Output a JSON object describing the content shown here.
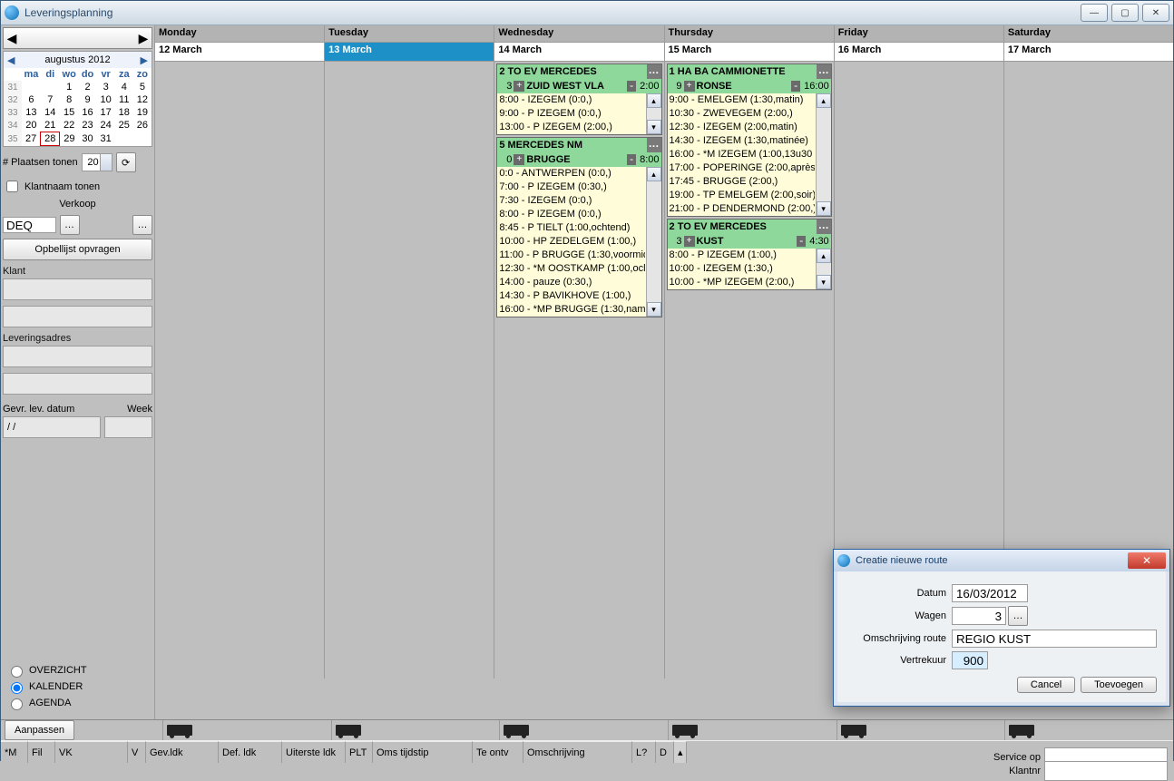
{
  "window": {
    "title": "Leveringsplanning"
  },
  "minical": {
    "title": "augustus 2012",
    "dow": [
      "ma",
      "di",
      "wo",
      "do",
      "vr",
      "za",
      "zo"
    ],
    "weeks": [
      {
        "wk": "31",
        "d": [
          "",
          "",
          "1",
          "2",
          "3",
          "4",
          "5"
        ]
      },
      {
        "wk": "32",
        "d": [
          "6",
          "7",
          "8",
          "9",
          "10",
          "11",
          "12"
        ]
      },
      {
        "wk": "33",
        "d": [
          "13",
          "14",
          "15",
          "16",
          "17",
          "18",
          "19"
        ]
      },
      {
        "wk": "34",
        "d": [
          "20",
          "21",
          "22",
          "23",
          "24",
          "25",
          "26"
        ]
      },
      {
        "wk": "35",
        "d": [
          "27",
          "28",
          "29",
          "30",
          "31",
          "",
          ""
        ]
      }
    ],
    "today": "28"
  },
  "sidebar": {
    "plaatsen_lbl": "# Plaatsen tonen",
    "plaatsen_val": "20",
    "klantnaam_lbl": "Klantnaam tonen",
    "verkoop_lbl": "Verkoop",
    "deq": "DEQ",
    "opbel_btn": "Opbellijst opvragen",
    "klant_lbl": "Klant",
    "lev_lbl": "Leveringsadres",
    "gevr_lbl": "Gevr. lev. datum",
    "week_lbl": "Week",
    "date_blank": "/  /",
    "views": {
      "overzicht": "OVERZICHT",
      "kalender": "KALENDER",
      "agenda": "AGENDA"
    },
    "aanpassen": "Aanpassen"
  },
  "days": [
    {
      "name": "Monday",
      "date": "12 March"
    },
    {
      "name": "Tuesday",
      "date": "13 March",
      "selected": true
    },
    {
      "name": "Wednesday",
      "date": "14 March"
    },
    {
      "name": "Thursday",
      "date": "15 March"
    },
    {
      "name": "Friday",
      "date": "16 March"
    },
    {
      "name": "Saturday",
      "date": "17 March"
    }
  ],
  "routes_wed": [
    {
      "hdr": "2 TO EV MERCEDES",
      "num": "3",
      "name": "ZUID WEST VLA",
      "time": "2:00",
      "items": [
        "8:00 - IZEGEM (0:0,)",
        "9:00 - P IZEGEM (0:0,)",
        "13:00 - P IZEGEM (2:00,)"
      ]
    },
    {
      "hdr": "5   MERCEDES NM",
      "num": "0",
      "name": "BRUGGE",
      "time": "8:00",
      "items": [
        "0:0 - ANTWERPEN (0:0,)",
        "7:00 - P IZEGEM (0:30,)",
        "7:30 - IZEGEM (0:0,)",
        "8:00 - P IZEGEM (0:0,)",
        "8:45 - P TIELT (1:00,ochtend)",
        "10:00 - HP ZEDELGEM (1:00,)",
        "11:00 - P BRUGGE (1:30,voormid",
        "12:30 - *M OOSTKAMP (1:00,ocl",
        "14:00 - pauze (0:30,)",
        "14:30 - P BAVIKHOVE (1:00,)",
        "16:00 - *MP BRUGGE (1:30,nam"
      ]
    }
  ],
  "routes_thu": [
    {
      "hdr": "1 HA BA CAMMIONETTE",
      "num": "9",
      "name": "RONSE",
      "time": "16:00",
      "items": [
        "9:00 - EMELGEM (1:30,matin)",
        "10:30 - ZWEVEGEM (2:00,)",
        "12:30 - IZEGEM (2:00,matin)",
        "14:30 - IZEGEM (1:30,matinée)",
        "16:00 - *M IZEGEM (1:00,13u30",
        "17:00 - POPERINGE (2:00,après-",
        "17:45 - BRUGGE (2:00,)",
        "19:00 - TP EMELGEM (2:00,soir)",
        "21:00 - P DENDERMOND (2:00,)"
      ]
    },
    {
      "hdr": "2 TO EV MERCEDES",
      "num": "3",
      "name": "KUST",
      "time": "4:30",
      "items": [
        "8:00 - P IZEGEM (1:00,)",
        "10:00 - IZEGEM (1:30,)",
        "10:00 - *MP IZEGEM (2:00,)"
      ]
    }
  ],
  "grid": {
    "cols": [
      "*M",
      "Fil",
      "VK",
      "V",
      "Gev.ldk",
      "Def. ldk",
      "Uiterste ldk",
      "PLT",
      "Oms tijdstip",
      "Te ontv",
      "Omschrijving",
      "L?",
      "D"
    ],
    "widths": [
      30,
      30,
      80,
      20,
      80,
      70,
      70,
      30,
      110,
      56,
      120,
      26,
      20
    ],
    "service_lbl": "Service op",
    "klantnr_lbl": "Klantnr"
  },
  "dialog": {
    "title": "Creatie nieuwe route",
    "datum_lbl": "Datum",
    "datum_val": "16/03/2012",
    "wagen_lbl": "Wagen",
    "wagen_val": "3",
    "omschr_lbl": "Omschrijving route",
    "omschr_val": "REGIO KUST",
    "vertrek_lbl": "Vertrekuur",
    "vertrek_val": "900",
    "cancel": "Cancel",
    "ok": "Toevoegen"
  }
}
